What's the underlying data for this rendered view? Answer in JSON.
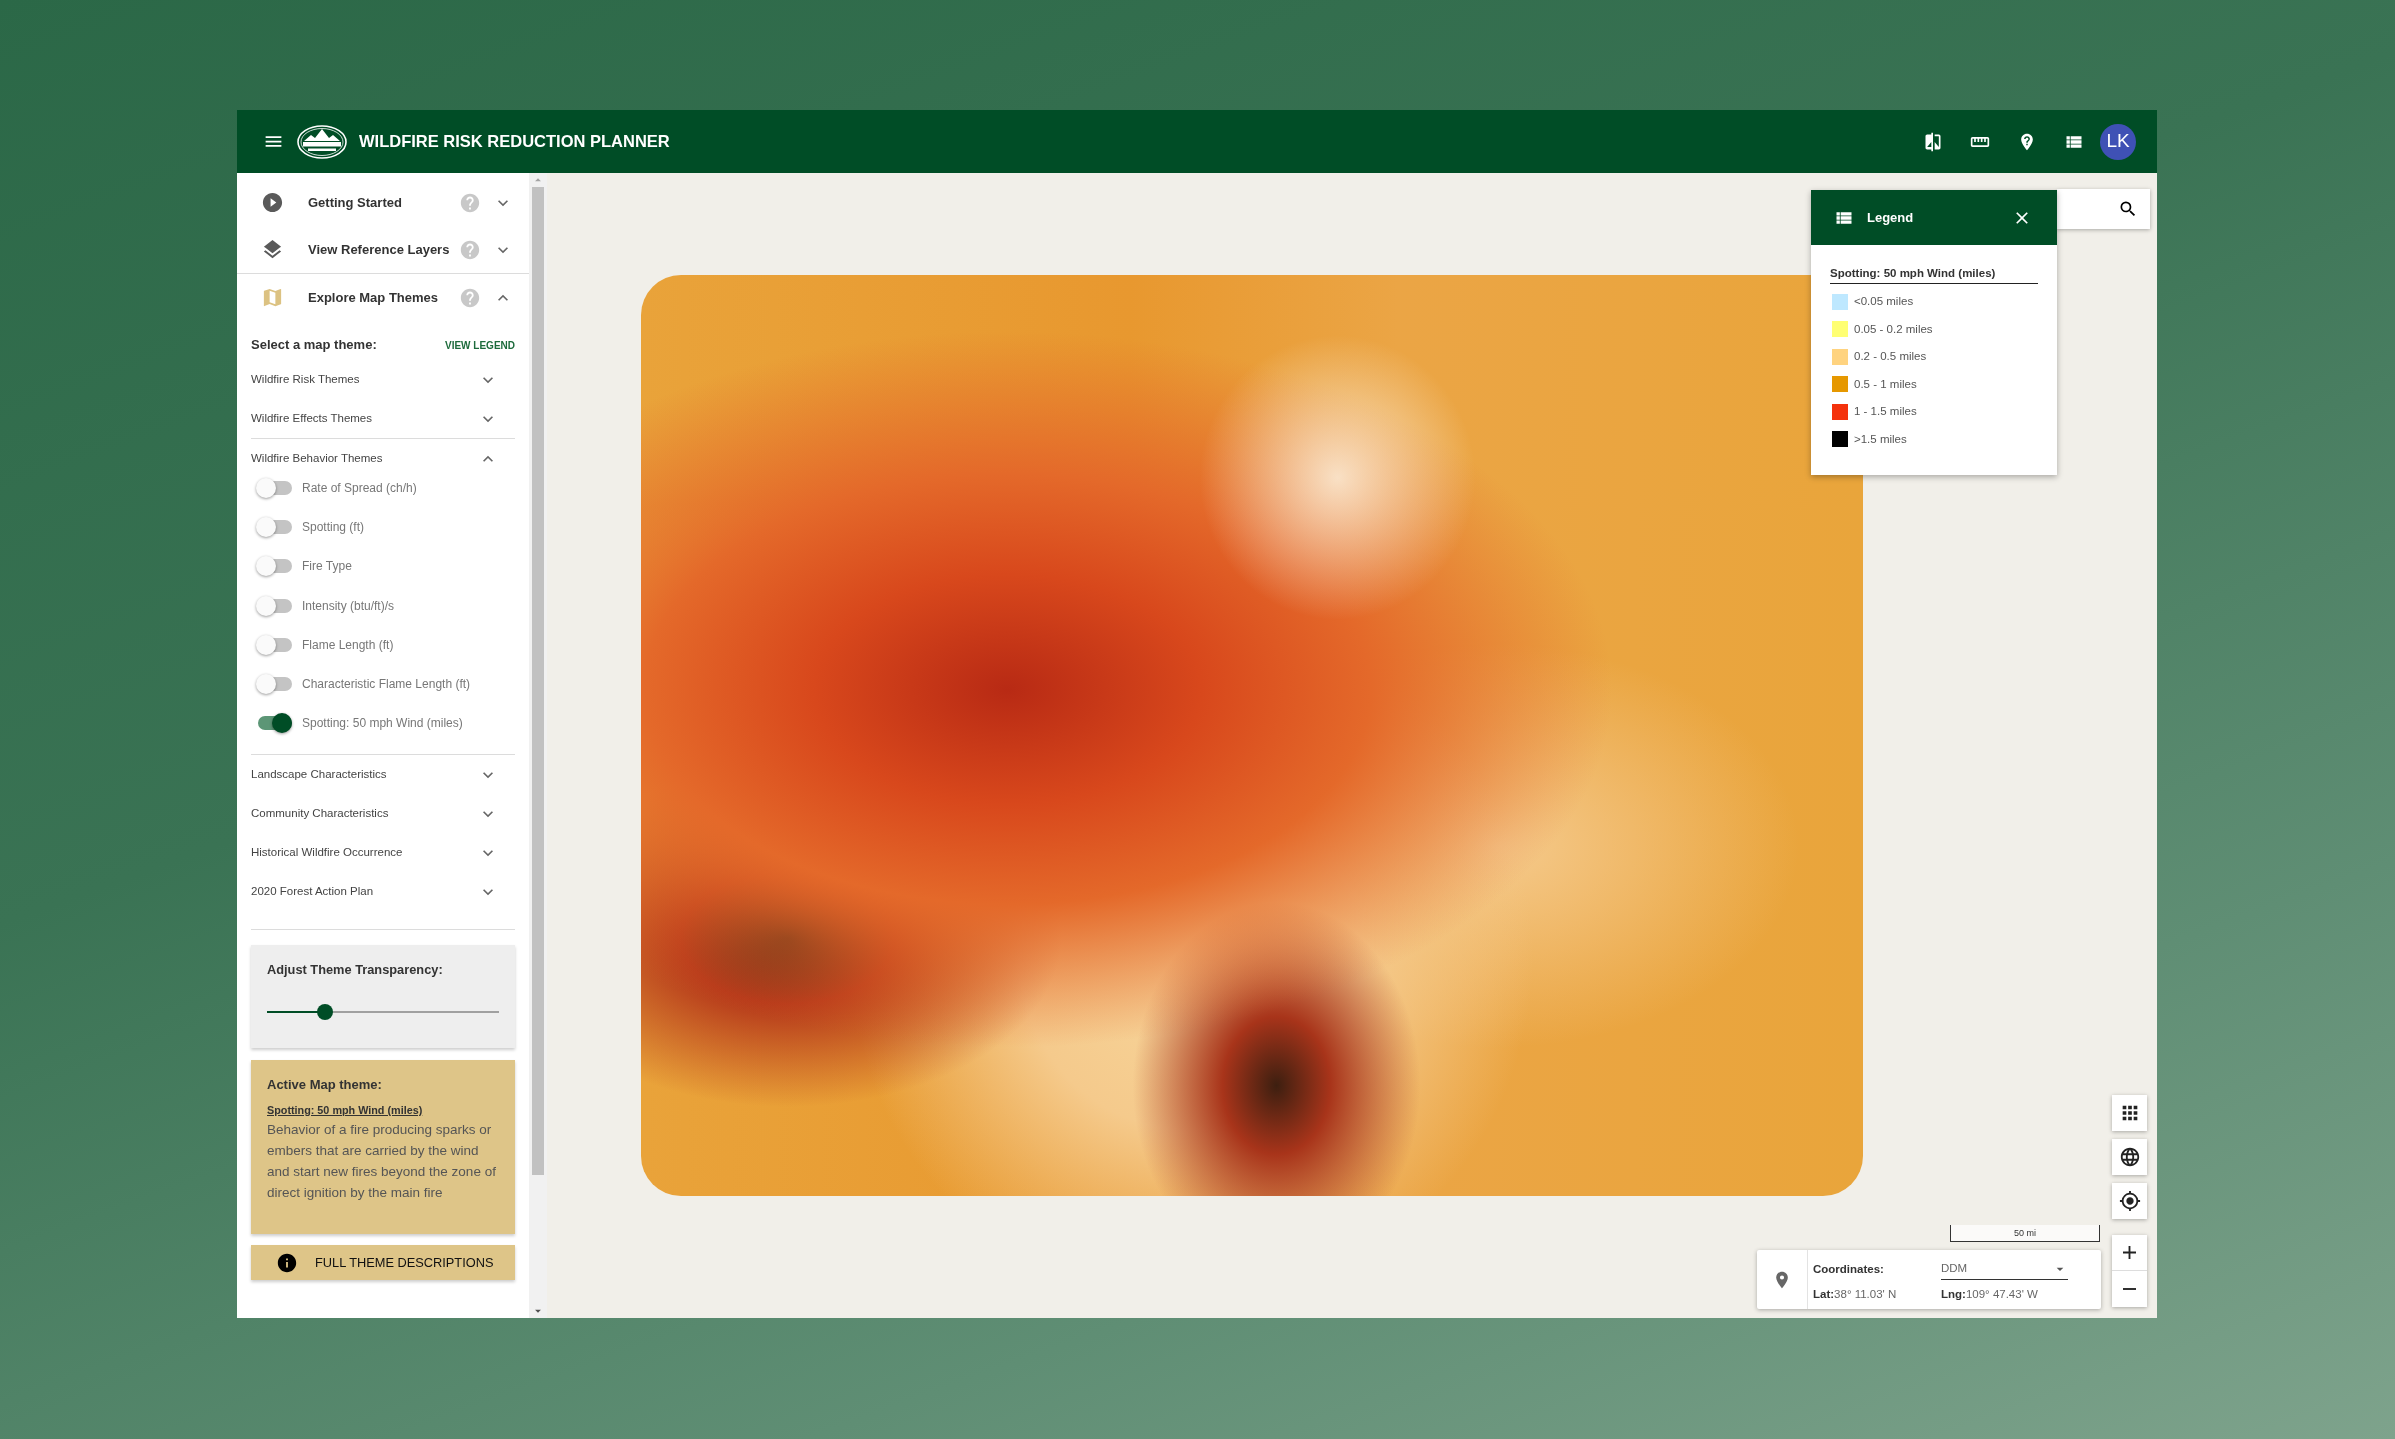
{
  "header": {
    "title": "WILDFIRE RISK REDUCTION PLANNER",
    "avatar": "LK"
  },
  "sidebar": {
    "sections": [
      {
        "label": "Getting Started",
        "expanded": false
      },
      {
        "label": "View Reference Layers",
        "expanded": false
      },
      {
        "label": "Explore Map Themes",
        "expanded": true,
        "heading": "Select a map theme:",
        "link": "VIEW LEGEND",
        "groups": [
          {
            "label": "Wildfire Risk Themes",
            "expanded": false
          },
          {
            "label": "Wildfire Effects Themes",
            "expanded": false
          },
          {
            "label": "Wildfire Behavior Themes",
            "expanded": true,
            "children": [
              {
                "label": "Rate of Spread (ch/h)",
                "on": false
              },
              {
                "label": "Spotting (ft)",
                "on": false
              },
              {
                "label": "Fire Type",
                "on": false
              },
              {
                "label": "Intensity (btu/ft)/s",
                "on": false
              },
              {
                "label": "Flame Length (ft)",
                "on": false
              },
              {
                "label": "Characteristic Flame Length (ft)",
                "on": false
              },
              {
                "label": "Spotting: 50 mph Wind (miles)",
                "on": true
              }
            ]
          },
          {
            "label": "Landscape Characteristics",
            "expanded": false
          },
          {
            "label": "Community Characteristics",
            "expanded": false
          },
          {
            "label": "Historical Wildfire Occurrence",
            "expanded": false
          },
          {
            "label": "2020 Forest Action Plan",
            "expanded": false
          }
        ]
      }
    ],
    "transparency": {
      "title": "Adjust Theme Transparency:",
      "level": 0.25
    },
    "active_theme": {
      "title": "Active Map theme:",
      "name": "Spotting: 50 mph Wind (miles)",
      "description": "Behavior of a fire producing sparks or embers that are carried by the wind and start new fires beyond the zone of direct ignition by the main fire"
    },
    "descriptions_button": "FULL THEME DESCRIPTIONS"
  },
  "legend": {
    "title": "Legend",
    "subtitle": "Spotting: 50 mph Wind (miles)",
    "items": [
      {
        "label": "<0.05 miles",
        "color": "#bee8ff"
      },
      {
        "label": "0.05 - 0.2 miles",
        "color": "#ffff73"
      },
      {
        "label": "0.2 - 0.5 miles",
        "color": "#ffd37f"
      },
      {
        "label": "0.5 - 1 miles",
        "color": "#e69800"
      },
      {
        "label": "1 - 1.5 miles",
        "color": "#f4320c"
      },
      {
        "label": ">1.5 miles",
        "color": "#000000"
      }
    ]
  },
  "scale_bar": "50 mi",
  "coordinates": {
    "label": "Coordinates:",
    "format": "DDM",
    "lat": "**Lat:**38° 11.03' N",
    "lng": "**Lng:**109° 47.43' W"
  }
}
